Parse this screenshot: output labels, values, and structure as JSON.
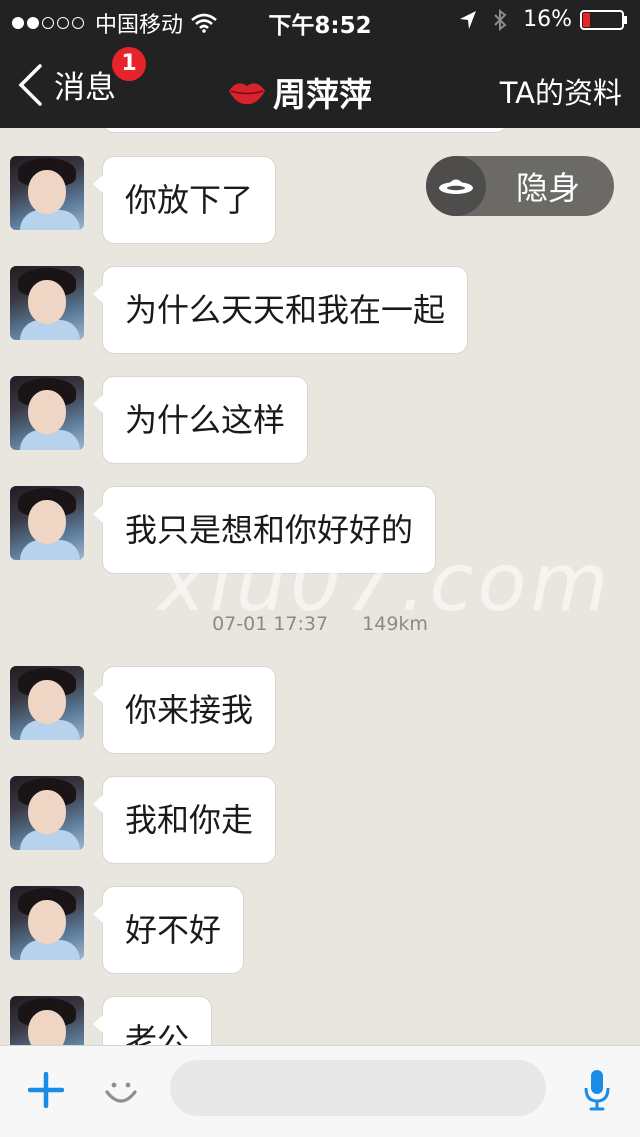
{
  "status_bar": {
    "carrier": "中国移动",
    "time": "下午8:52",
    "battery": "16%"
  },
  "nav": {
    "back_label": "消息",
    "badge_count": "1",
    "title": "周萍萍",
    "profile_label": "TA的资料"
  },
  "stealth": {
    "label": "隐身"
  },
  "messages": [
    {
      "text": "你放下了"
    },
    {
      "text": "为什么天天和我在一起"
    },
    {
      "text": "为什么这样"
    },
    {
      "text": "我只是想和你好好的"
    },
    {
      "text": "你来接我"
    },
    {
      "text": "我和你走"
    },
    {
      "text": "好不好"
    },
    {
      "text": "老公"
    }
  ],
  "meta": {
    "time": "07-01 17:37",
    "distance": "149km"
  },
  "watermark": "xiu07.com",
  "input": {
    "placeholder": ""
  },
  "colors": {
    "header_bg": "#222223",
    "chat_bg": "#e9e6df",
    "badge": "#e8242b",
    "accent_blue": "#1a8ce8"
  }
}
